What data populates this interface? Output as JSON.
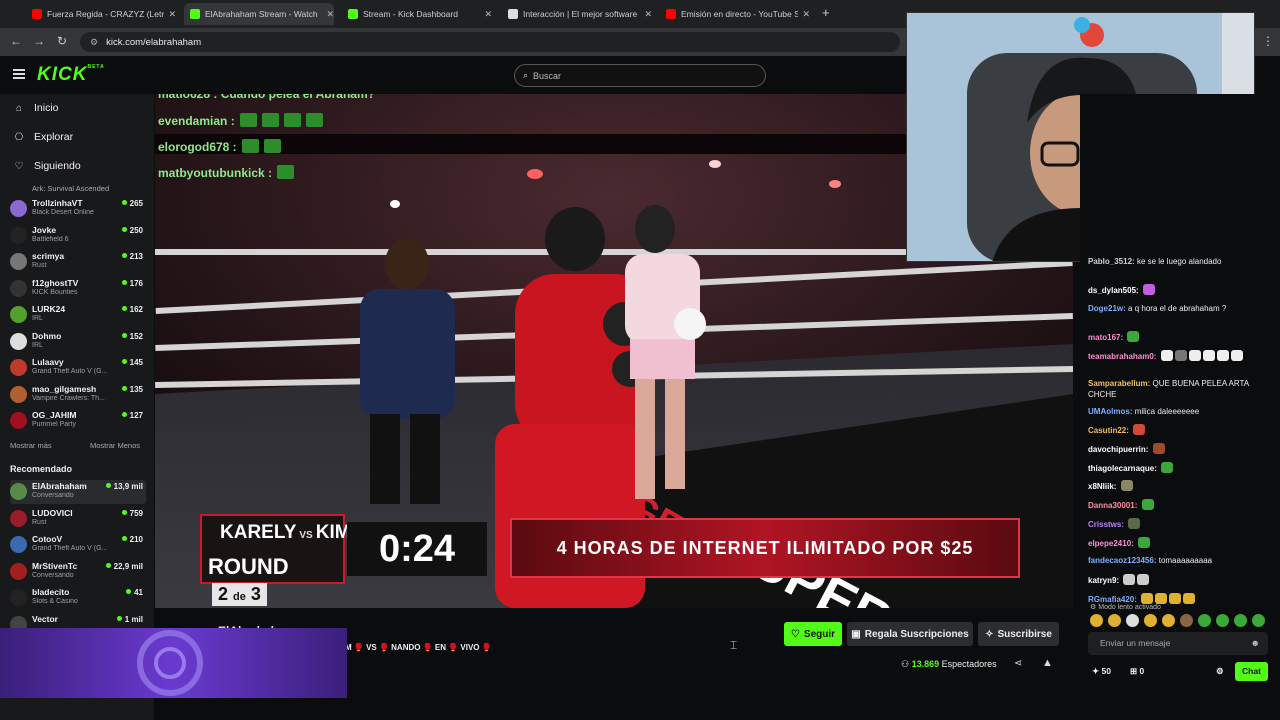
{
  "browser": {
    "tabs": [
      {
        "title": "Fuerza Regida - CRAZYZ (Letra)",
        "color": "#ff0000"
      },
      {
        "title": "ElAbrahaham Stream - Watch",
        "color": "#53fc18"
      },
      {
        "title": "Stream - Kick Dashboard",
        "color": "#53fc18"
      },
      {
        "title": "Interacción | El mejor software p",
        "color": "#dddddd"
      },
      {
        "title": "Emisión en directo - YouTube S",
        "color": "#ff0000"
      }
    ],
    "url": "kick.com/elabrahaham",
    "new_tab": "+"
  },
  "topnav": {
    "logo": "KICK",
    "logo_sup": "BETA",
    "search_placeholder": "Buscar"
  },
  "sidebar": {
    "nav": [
      {
        "label": "Inicio",
        "icon": "home-icon"
      },
      {
        "label": "Explorar",
        "icon": "compass-icon"
      },
      {
        "label": "Siguiendo",
        "icon": "heart-icon"
      }
    ],
    "following_partial_game": "Ark: Survival Ascended",
    "following": [
      {
        "name": "TrollzinhaVT",
        "game": "Black Desert Online",
        "viewers": "265",
        "color": "#8a6ad0"
      },
      {
        "name": "Jovke",
        "game": "Battlefield 6",
        "viewers": "250",
        "color": "#222222"
      },
      {
        "name": "scrimya",
        "game": "Rust",
        "viewers": "213",
        "color": "#777777"
      },
      {
        "name": "f12ghostTV",
        "game": "KICK Bounties",
        "viewers": "176",
        "color": "#333333"
      },
      {
        "name": "LURK24",
        "game": "IRL",
        "viewers": "162",
        "color": "#53a02a"
      },
      {
        "name": "Dohmo",
        "game": "IRL",
        "viewers": "152",
        "color": "#dddddd"
      },
      {
        "name": "Lulaavy",
        "game": "Grand Theft Auto V (G...",
        "viewers": "145",
        "color": "#c0392b"
      },
      {
        "name": "mao_gilgamesh",
        "game": "Vampire Crawlers: Th...",
        "viewers": "135",
        "color": "#b06030"
      },
      {
        "name": "OG_JAHIM",
        "game": "Pummel Party",
        "viewers": "127",
        "color": "#a01020"
      }
    ],
    "show_more": "Mostrar más",
    "show_less": "Mostrar Menos",
    "recommended_title": "Recomendado",
    "recommended": [
      {
        "name": "ElAbrahaham",
        "game": "Conversando",
        "viewers": "13,9 mil",
        "color": "#5a8a4a"
      },
      {
        "name": "LUDOVICI",
        "game": "Rust",
        "viewers": "759",
        "color": "#9b1b2a"
      },
      {
        "name": "CotooV",
        "game": "Grand Theft Auto V (G...",
        "viewers": "210",
        "color": "#3a6ab0"
      },
      {
        "name": "MrStivenTc",
        "game": "Conversando",
        "viewers": "22,9 mil",
        "color": "#a02020"
      },
      {
        "name": "bladecito",
        "game": "Slots & Casino",
        "viewers": "41",
        "color": "#222222"
      },
      {
        "name": "Vector",
        "game": "",
        "viewers": "1 mil",
        "color": "#444444"
      }
    ]
  },
  "overlay_chat": [
    {
      "user": "matio628 : Cuando pelea el Abraham?",
      "emotes": 0
    },
    {
      "user": "evendamian :",
      "emotes": 4
    },
    {
      "user": "elorogod678 :",
      "emotes": 2
    },
    {
      "user": "matbyoutubunkick :",
      "emotes": 1
    }
  ],
  "scoreboard": {
    "fighter_a": "KARELY",
    "vs": "VS",
    "fighter_b": "KIM",
    "round_label": "ROUND",
    "round": "2",
    "round_sep": "de",
    "round_total": "3",
    "clock": "0:24",
    "ad": "4 HORAS DE INTERNET ILIMITADO POR $25"
  },
  "chat": {
    "messages": [
      {
        "user": "Pablo_3512:",
        "text": "ke se le luego alandado",
        "color": "#cfcfcf",
        "emotes": []
      },
      {
        "user": "ds_dylan505:",
        "text": "",
        "color": "#ffffff",
        "emotes": [
          "#c060e0"
        ]
      },
      {
        "user": "Doge21w:",
        "text": "a q hora el de abrahaham ?",
        "color": "#7fb0ff",
        "emotes": []
      },
      {
        "user": "mato167:",
        "text": "",
        "color": "#ff8fd0",
        "emotes": [
          "#3aa83a"
        ]
      },
      {
        "user": "teamabrahaham0:",
        "text": "",
        "color": "#ff8fd0",
        "emotes": [
          "#eeeeee",
          "#777777",
          "#eeeeee",
          "#eeeeee",
          "#eeeeee",
          "#eeeeee"
        ]
      },
      {
        "user": "Samparabellum:",
        "text": "QUE BUENA PELEA ARTA CHCHE",
        "color": "#f0c060",
        "emotes": []
      },
      {
        "user": "UMAolmos:",
        "text": "milica daleeeeeee",
        "color": "#7fb0ff",
        "emotes": []
      },
      {
        "user": "Casutin22:",
        "text": "",
        "color": "#f0c060",
        "emotes": [
          "#d04a3a"
        ]
      },
      {
        "user": "davochipuerrin:",
        "text": "",
        "color": "#ffffff",
        "emotes": [
          "#a04a2a"
        ]
      },
      {
        "user": "thiagolecarnaque:",
        "text": "",
        "color": "#ffffff",
        "emotes": [
          "#3aa83a"
        ]
      },
      {
        "user": "x8Nliik:",
        "text": "",
        "color": "#ffffff",
        "emotes": [
          "#888866"
        ]
      },
      {
        "user": "Danna30001:",
        "text": "",
        "color": "#ff8fa0",
        "emotes": [
          "#3aa83a"
        ]
      },
      {
        "user": "Crisstws:",
        "text": "",
        "color": "#c080ff",
        "emotes": [
          "#5a6a4a"
        ]
      },
      {
        "user": "elpepe2410:",
        "text": "",
        "color": "#ff8fd0",
        "emotes": [
          "#3aa83a"
        ]
      },
      {
        "user": "fandecaoz123456:",
        "text": "tomaaaaaaaaa",
        "color": "#7fb0ff",
        "emotes": []
      },
      {
        "user": "katryn9:",
        "text": "",
        "color": "#ffffff",
        "emotes": [
          "#cccccc",
          "#cccccc"
        ]
      },
      {
        "user": "RGmafia420:",
        "text": "",
        "color": "#7fb0ff",
        "emotes": [
          "#e0b030",
          "#e0b030",
          "#e0b030",
          "#e0b030"
        ]
      }
    ],
    "slow_mode": "Modo lento activado",
    "input_placeholder": "Enviar un mensaje",
    "points": "50",
    "gifts": "0",
    "send_label": "Chat"
  },
  "stream_info": {
    "streamer": "ElAbrahaham",
    "title": "M 🥊 VS 🥊 NANDO 🥊 EN 🥊 VIVO 🥊",
    "follow_label": "Seguir",
    "gift_label": "Regala Suscripciones",
    "sub_label": "Suscribirse",
    "viewers": "13.869",
    "viewers_label": "Espectadores"
  }
}
